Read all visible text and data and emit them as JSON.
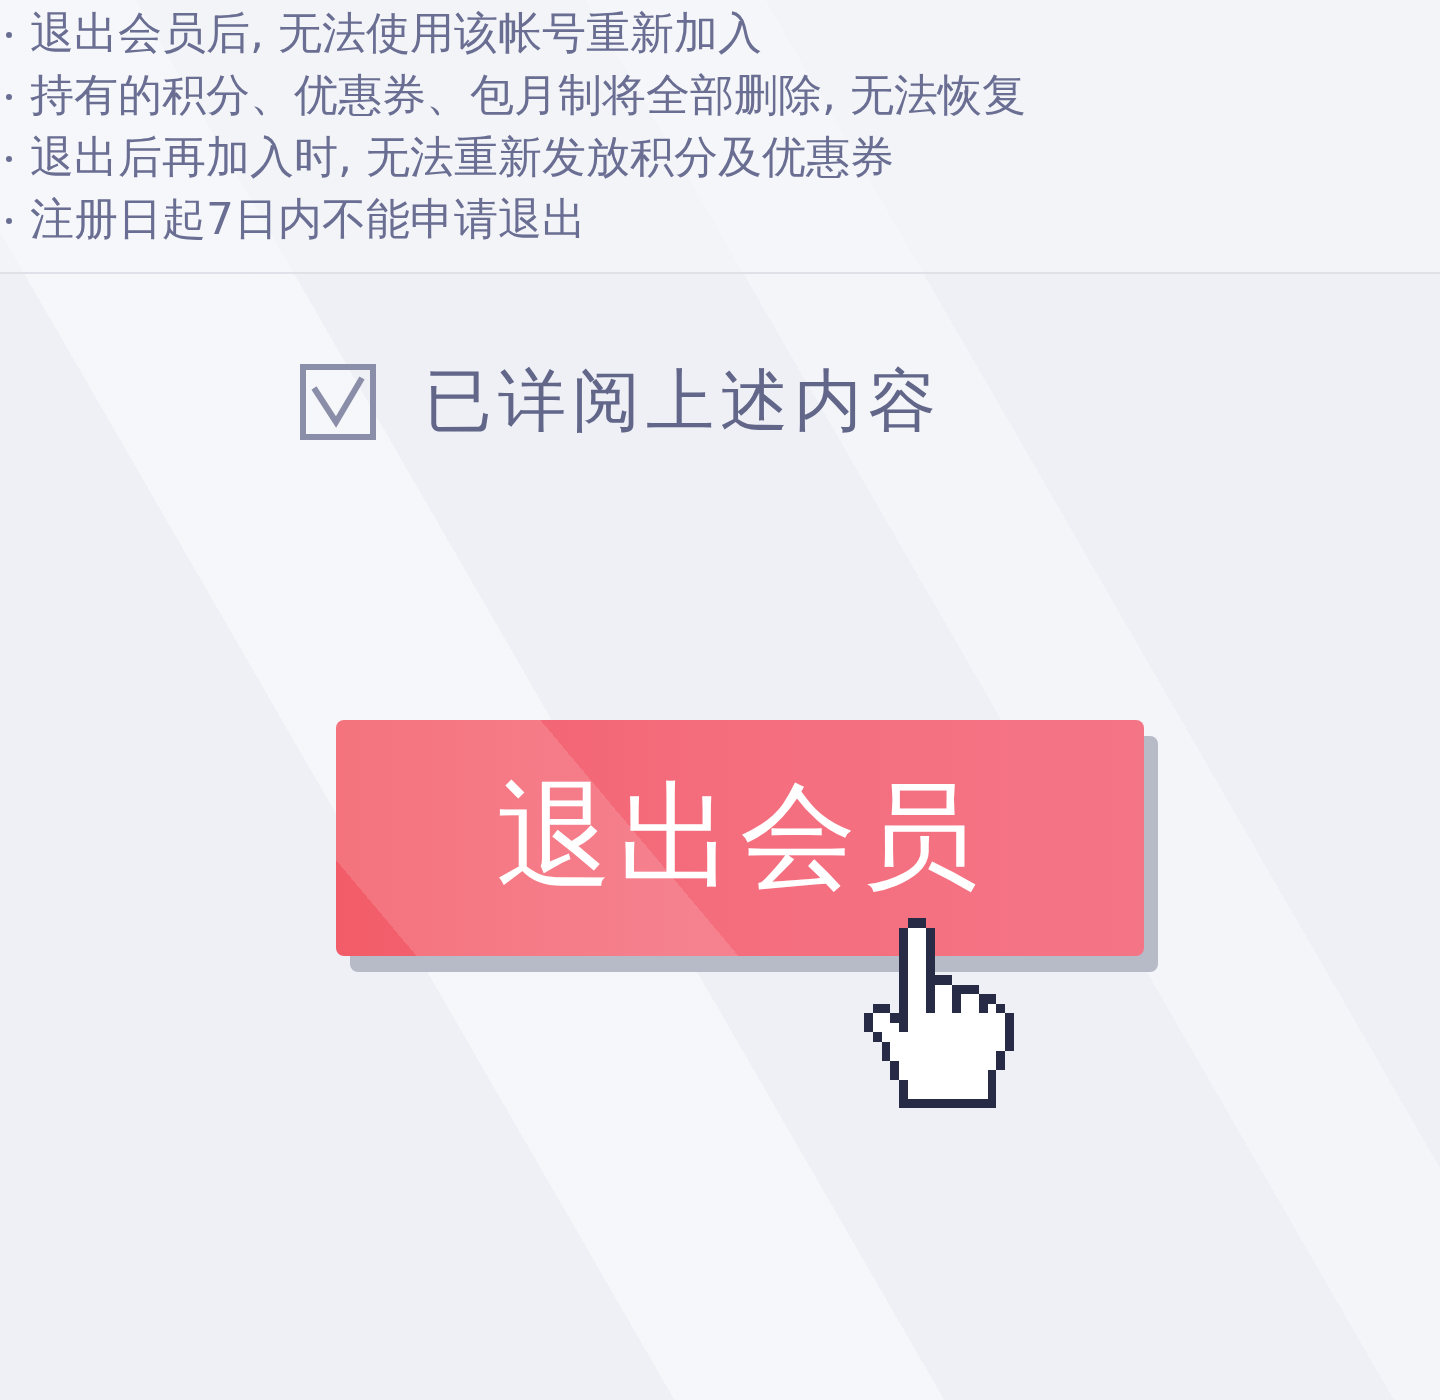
{
  "notice": {
    "items": [
      "退出会员后, 无法使用该帐号重新加入",
      "持有的积分、优惠券、包月制将全部删除, 无法恢复",
      "退出后再加入时, 无法重新发放积分及优惠券",
      "注册日起7日内不能申请退出"
    ]
  },
  "agreement": {
    "label": "已详阅上述内容",
    "checked": true
  },
  "withdraw_button": {
    "label": "退出会员"
  }
}
